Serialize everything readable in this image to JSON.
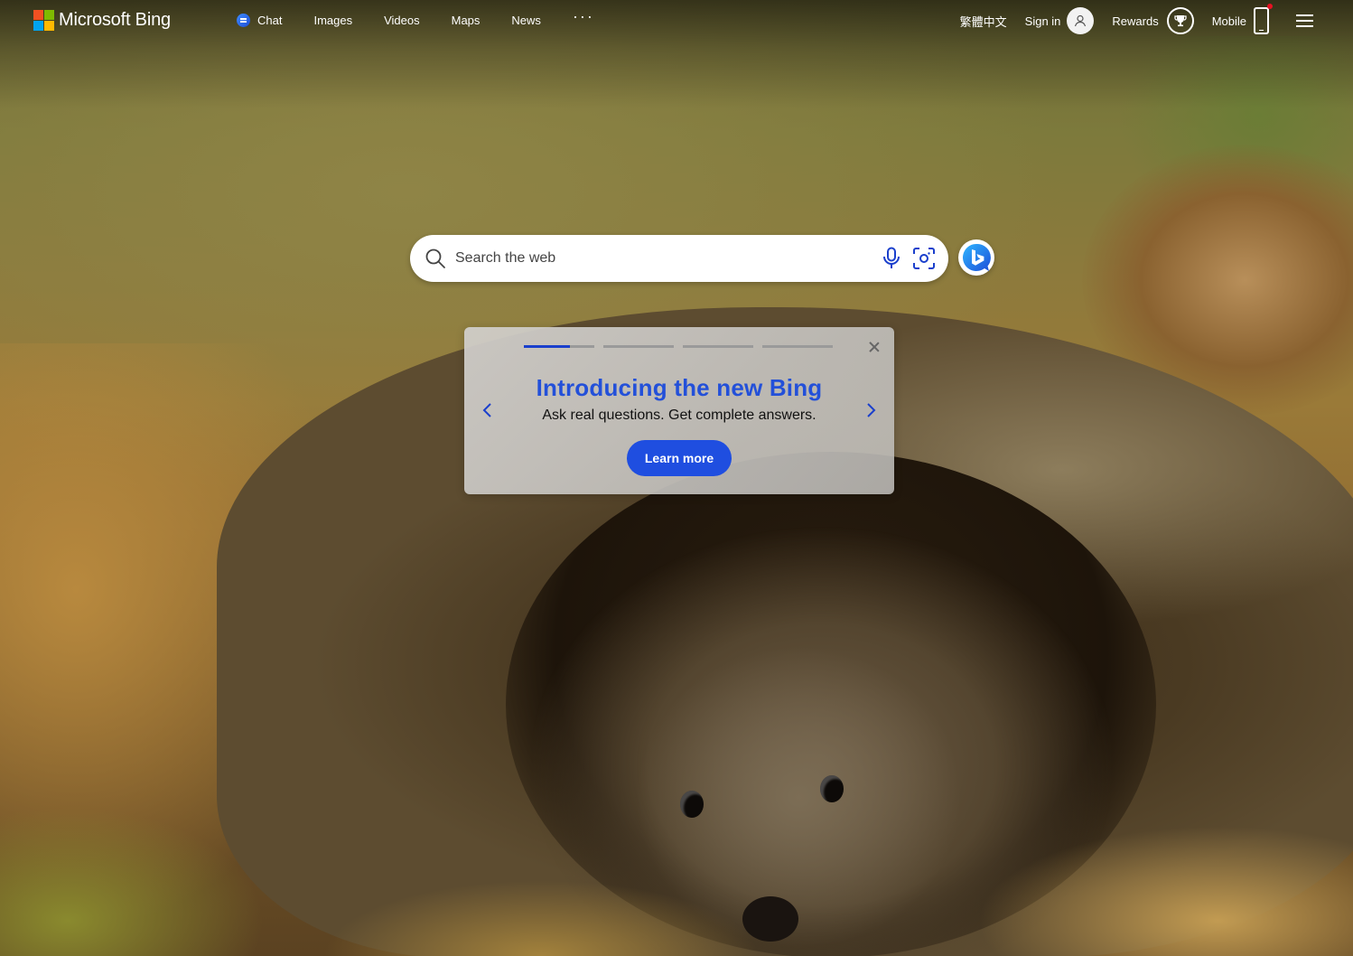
{
  "brand": {
    "name": "Microsoft Bing",
    "logo_colors": [
      "#f25022",
      "#7fba00",
      "#00a4ef",
      "#ffb900"
    ]
  },
  "nav": {
    "chat": "Chat",
    "images": "Images",
    "videos": "Videos",
    "maps": "Maps",
    "news": "News",
    "more": "···"
  },
  "header_right": {
    "language": "繁體中文",
    "sign_in": "Sign in",
    "rewards": "Rewards",
    "mobile": "Mobile",
    "notification_color": "#e81123"
  },
  "search": {
    "placeholder": "Search the web",
    "icons": [
      "search-icon",
      "microphone-icon",
      "visual-search-icon"
    ]
  },
  "copilot": {
    "icon": "bing-copilot-icon"
  },
  "promo": {
    "title": "Introducing the new Bing",
    "subtitle": "Ask real questions. Get complete answers.",
    "button": "Learn more",
    "slides_total": 4,
    "current_slide": 1,
    "current_progress": 0.65,
    "accent_color": "#1f4ee0"
  }
}
